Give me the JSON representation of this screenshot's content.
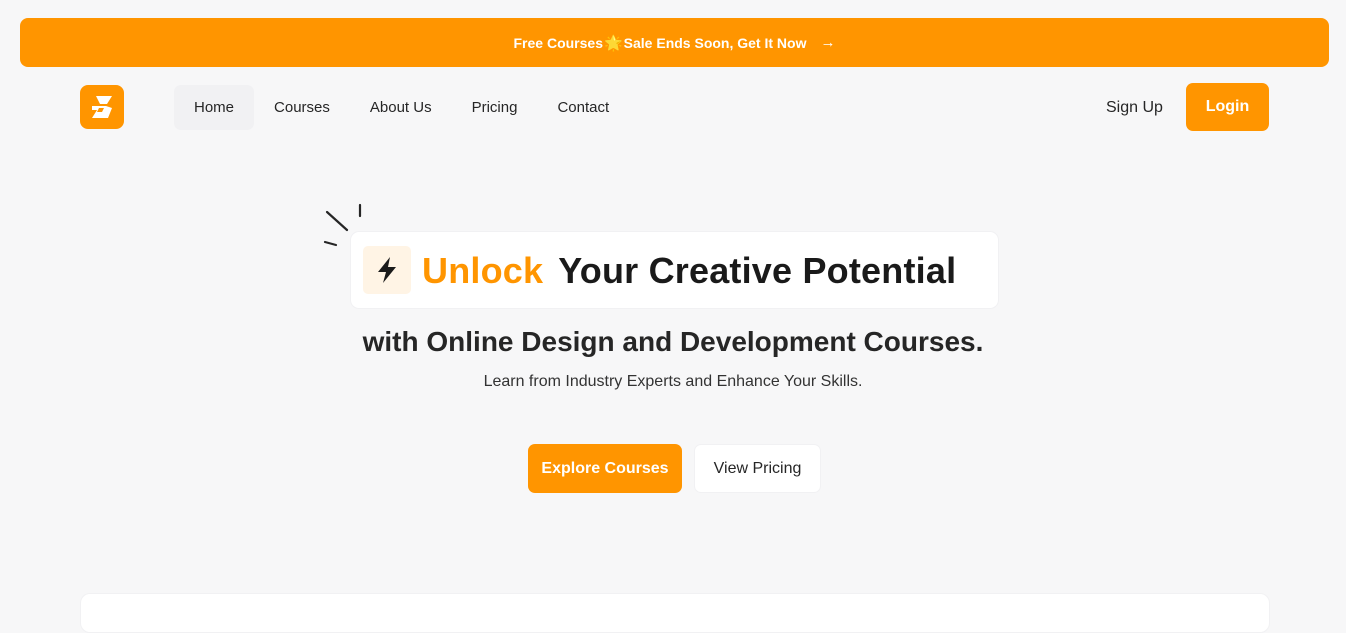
{
  "banner": {
    "text_before": "Free Courses",
    "star": "🌟",
    "text_after": "Sale Ends Soon, Get It Now",
    "arrow": "→"
  },
  "nav": {
    "items": [
      {
        "label": "Home",
        "active": true
      },
      {
        "label": "Courses"
      },
      {
        "label": "About Us"
      },
      {
        "label": "Pricing"
      },
      {
        "label": "Contact"
      }
    ],
    "signup_label": "Sign Up",
    "login_label": "Login"
  },
  "hero": {
    "headline_accent": "Unlock",
    "headline_rest": "Your Creative Potential",
    "subline": "with Online Design and Development Courses.",
    "tagline": "Learn from Industry Experts and Enhance Your Skills.",
    "primary_cta": "Explore Courses",
    "secondary_cta": "View Pricing"
  },
  "colors": {
    "brand": "#ff9500",
    "background": "#f7f7f8",
    "text": "#262626"
  },
  "icons": {
    "logo": "logo-icon",
    "bolt": "lightning-bolt-icon",
    "arrow": "arrow-right-icon",
    "sparks": "sparkle-lines-icon"
  }
}
